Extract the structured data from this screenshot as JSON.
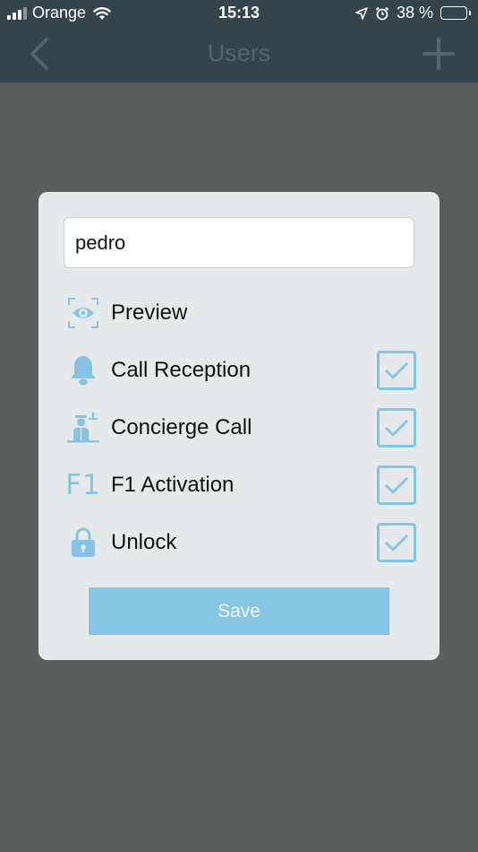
{
  "status_bar": {
    "carrier": "Orange",
    "time": "15:13",
    "battery": "38 %",
    "battery_level": 0.38
  },
  "nav": {
    "title": "Users",
    "back_icon": "chevron-left-icon",
    "add_icon": "plus-icon"
  },
  "form": {
    "name_value": "pedro",
    "permissions": [
      {
        "label": "Preview",
        "icon": "eye-icon",
        "has_checkbox": false
      },
      {
        "label": "Call Reception",
        "icon": "bell-icon",
        "has_checkbox": true,
        "checked": true
      },
      {
        "label": "Concierge Call",
        "icon": "concierge-icon",
        "has_checkbox": true,
        "checked": true
      },
      {
        "label": "F1 Activation",
        "icon_text": "F1",
        "has_checkbox": true,
        "checked": true
      },
      {
        "label": "Unlock",
        "icon": "padlock-icon",
        "has_checkbox": true,
        "checked": true
      }
    ],
    "save_label": "Save"
  },
  "colors": {
    "header": "#34454e",
    "overlay": "#5c5e5e",
    "accent": "#86c3e2",
    "modal": "#e6e9ea"
  }
}
